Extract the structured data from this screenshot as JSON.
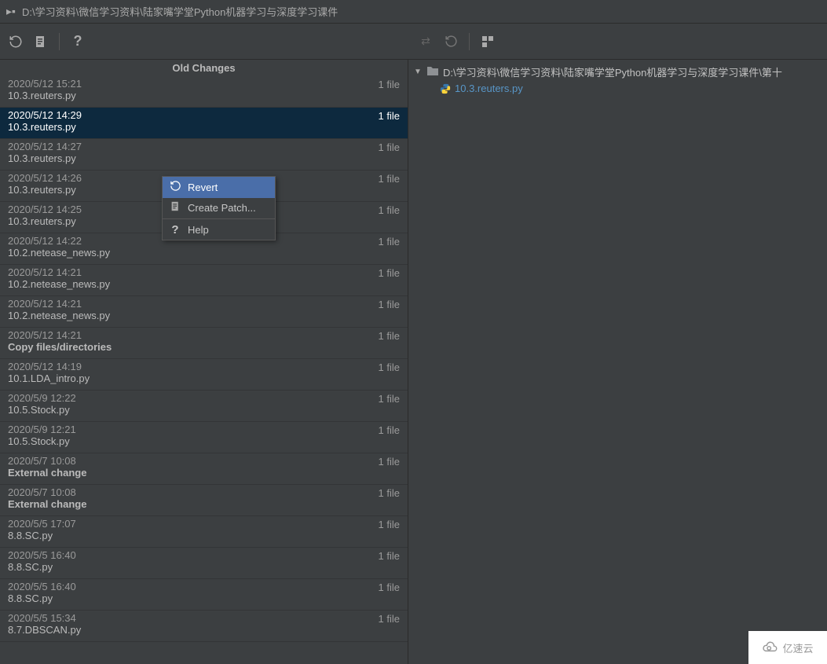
{
  "header": {
    "path": "D:\\学习资料\\微信学习资料\\陆家嘴学堂Python机器学习与深度学习课件"
  },
  "panel_title": "Old Changes",
  "selected_index": 1,
  "context_menu": {
    "revert": "Revert",
    "create_patch": "Create Patch...",
    "help": "Help"
  },
  "changes": [
    {
      "time": "2020/5/12 15:21",
      "title": "10.3.reuters.py",
      "count": "1 file",
      "bold": false
    },
    {
      "time": "2020/5/12 14:29",
      "title": "10.3.reuters.py",
      "count": "1 file",
      "bold": false
    },
    {
      "time": "2020/5/12 14:27",
      "title": "10.3.reuters.py",
      "count": "1 file",
      "bold": false
    },
    {
      "time": "2020/5/12 14:26",
      "title": "10.3.reuters.py",
      "count": "1 file",
      "bold": false
    },
    {
      "time": "2020/5/12 14:25",
      "title": "10.3.reuters.py",
      "count": "1 file",
      "bold": false
    },
    {
      "time": "2020/5/12 14:22",
      "title": "10.2.netease_news.py",
      "count": "1 file",
      "bold": false
    },
    {
      "time": "2020/5/12 14:21",
      "title": "10.2.netease_news.py",
      "count": "1 file",
      "bold": false
    },
    {
      "time": "2020/5/12 14:21",
      "title": "10.2.netease_news.py",
      "count": "1 file",
      "bold": false
    },
    {
      "time": "2020/5/12 14:21",
      "title": "Copy files/directories",
      "count": "1 file",
      "bold": true
    },
    {
      "time": "2020/5/12 14:19",
      "title": "10.1.LDA_intro.py",
      "count": "1 file",
      "bold": false
    },
    {
      "time": "2020/5/9 12:22",
      "title": "10.5.Stock.py",
      "count": "1 file",
      "bold": false
    },
    {
      "time": "2020/5/9 12:21",
      "title": "10.5.Stock.py",
      "count": "1 file",
      "bold": false
    },
    {
      "time": "2020/5/7 10:08",
      "title": "External change",
      "count": "1 file",
      "bold": true
    },
    {
      "time": "2020/5/7 10:08",
      "title": "External change",
      "count": "1 file",
      "bold": true
    },
    {
      "time": "2020/5/5 17:07",
      "title": "8.8.SC.py",
      "count": "1 file",
      "bold": false
    },
    {
      "time": "2020/5/5 16:40",
      "title": "8.8.SC.py",
      "count": "1 file",
      "bold": false
    },
    {
      "time": "2020/5/5 16:40",
      "title": "8.8.SC.py",
      "count": "1 file",
      "bold": false
    },
    {
      "time": "2020/5/5 15:34",
      "title": "8.7.DBSCAN.py",
      "count": "1 file",
      "bold": false
    }
  ],
  "tree": {
    "root_path": "D:\\学习资料\\微信学习资料\\陆家嘴学堂Python机器学习与深度学习课件\\第十",
    "file": "10.3.reuters.py"
  },
  "watermark": "亿速云"
}
